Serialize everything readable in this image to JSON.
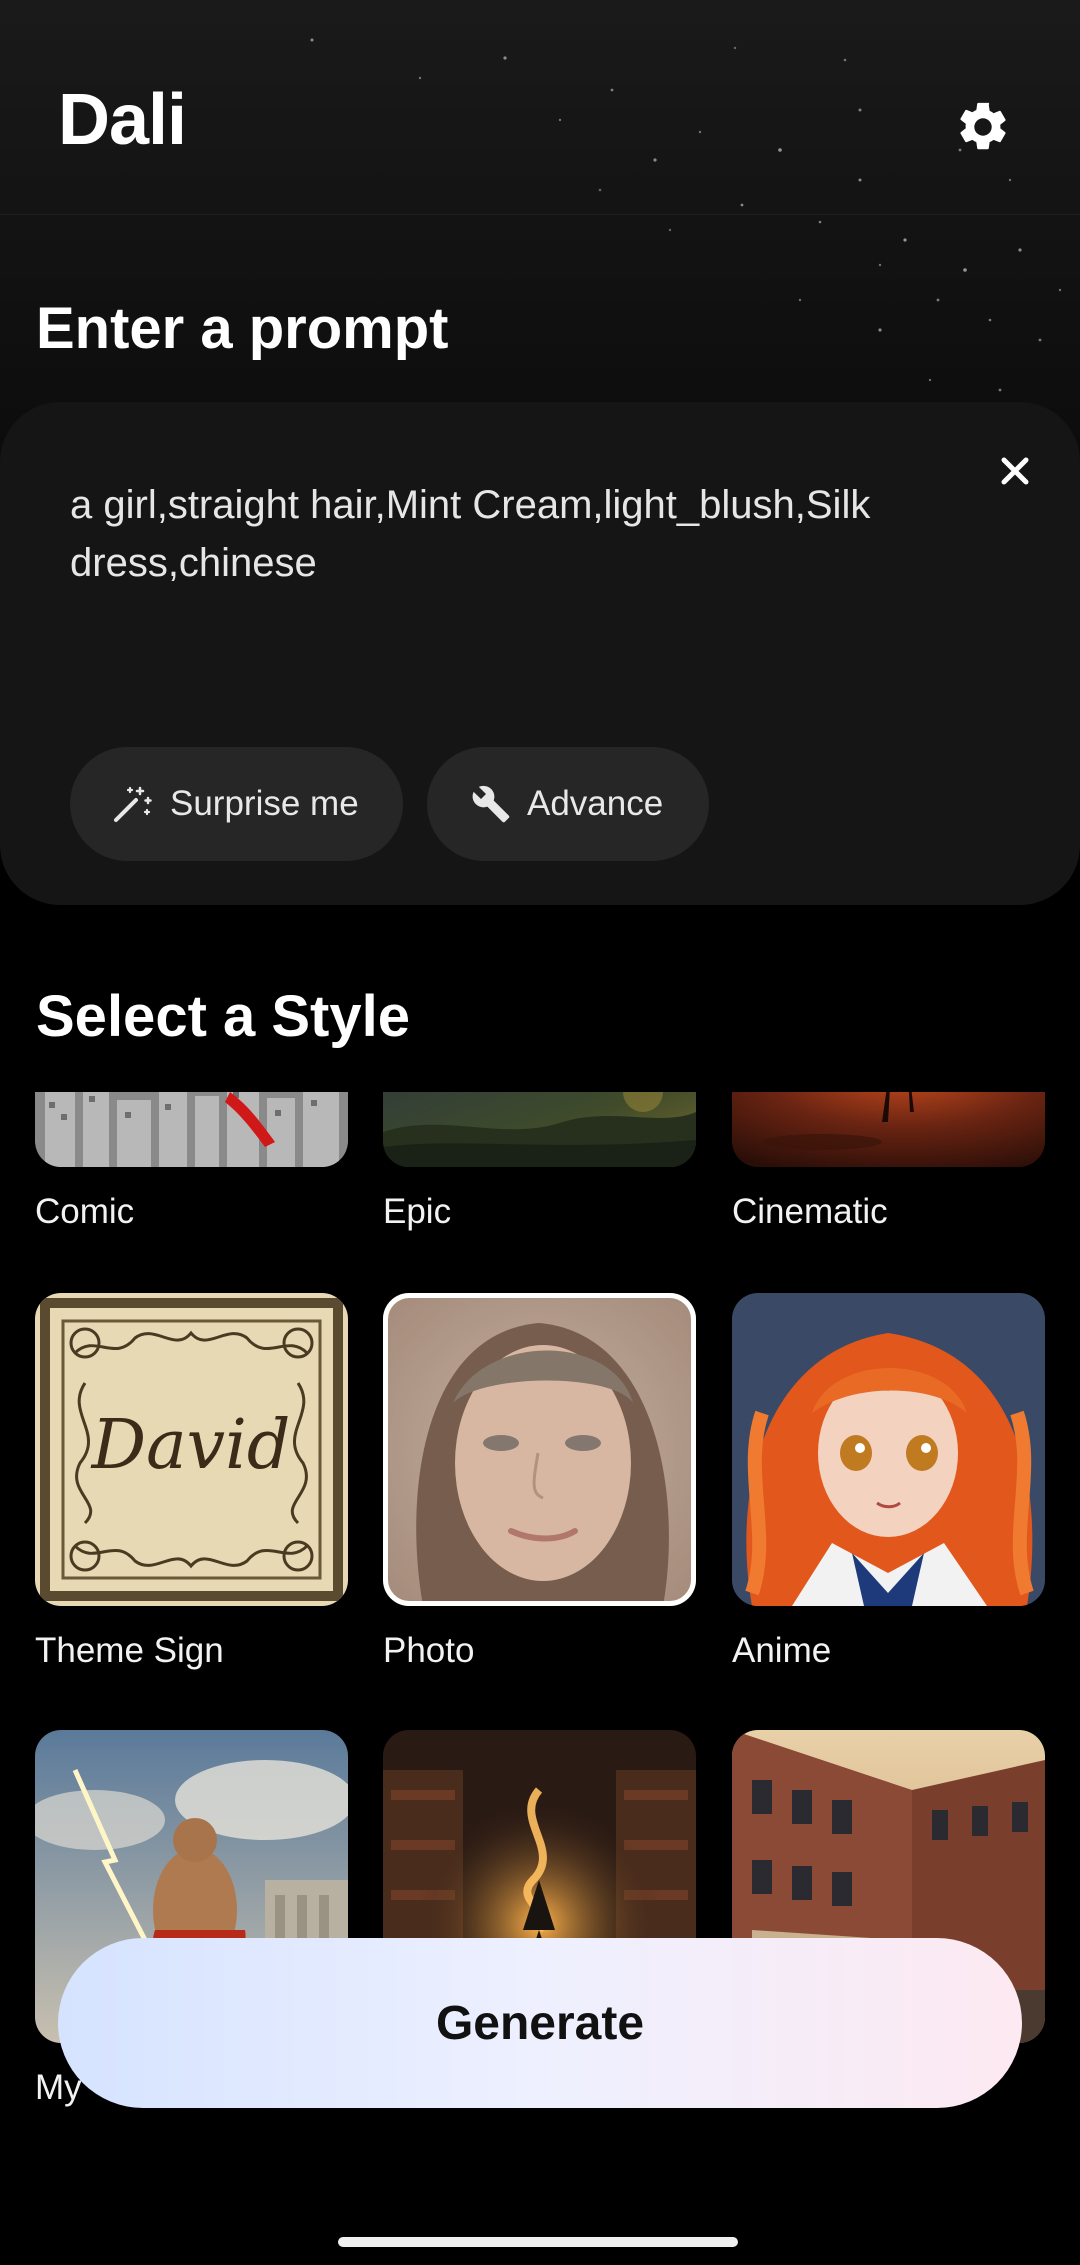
{
  "header": {
    "app_title": "Dali",
    "settings_icon": "gear-icon"
  },
  "prompt": {
    "section_title": "Enter a prompt",
    "text": "a girl,straight hair,Mint Cream,light_blush,Silk dress,chinese",
    "clear_icon": "close-icon",
    "surprise_label": "Surprise me",
    "surprise_icon": "magic-wand-icon",
    "advance_label": "Advance",
    "advance_icon": "wrench-icon"
  },
  "styles": {
    "section_title": "Select a Style",
    "selected": "Photo",
    "items": [
      {
        "label": "Comic"
      },
      {
        "label": "Epic"
      },
      {
        "label": "Cinematic"
      },
      {
        "label": "Theme Sign",
        "sign_text": "David"
      },
      {
        "label": "Photo"
      },
      {
        "label": "Anime"
      },
      {
        "label": "My"
      },
      {
        "label": ""
      },
      {
        "label": ""
      }
    ]
  },
  "generate_label": "Generate",
  "colors": {
    "background": "#000000",
    "card": "#151515",
    "chip": "#262626",
    "generate_gradient_start": "#d5e3ff",
    "generate_gradient_end": "#fde9f1"
  }
}
